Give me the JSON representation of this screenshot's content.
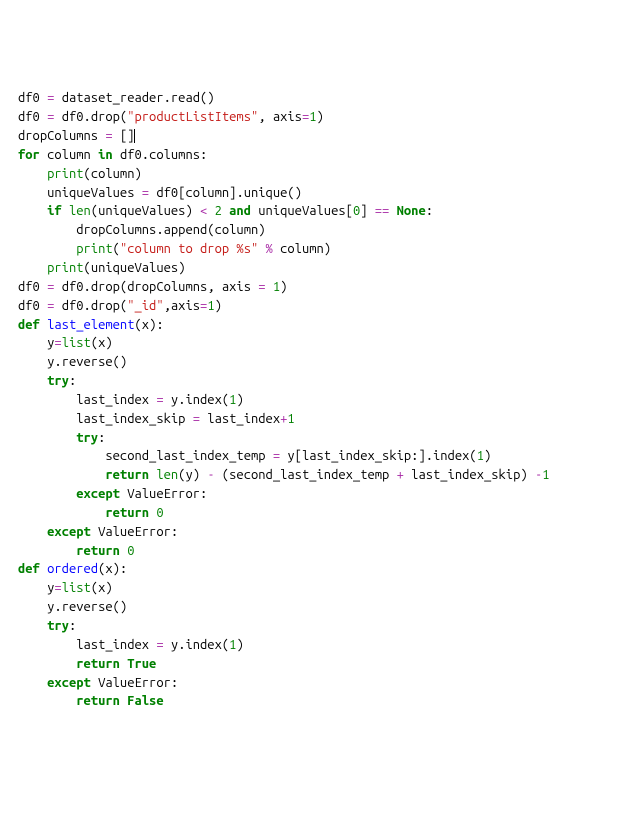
{
  "code": {
    "lines": [
      {
        "indent": 0,
        "tokens": [
          {
            "t": "df0",
            "c": "ident"
          },
          {
            "t": " ",
            "c": ""
          },
          {
            "t": "=",
            "c": "op"
          },
          {
            "t": " ",
            "c": ""
          },
          {
            "t": "dataset_reader",
            "c": "ident"
          },
          {
            "t": ".",
            "c": "dot"
          },
          {
            "t": "read",
            "c": "call"
          },
          {
            "t": "()",
            "c": "paren"
          }
        ]
      },
      {
        "indent": 0,
        "tokens": [
          {
            "t": "df0",
            "c": "ident"
          },
          {
            "t": " ",
            "c": ""
          },
          {
            "t": "=",
            "c": "op"
          },
          {
            "t": " ",
            "c": ""
          },
          {
            "t": "df0",
            "c": "ident"
          },
          {
            "t": ".",
            "c": "dot"
          },
          {
            "t": "drop",
            "c": "call"
          },
          {
            "t": "(",
            "c": "paren"
          },
          {
            "t": "\"productListItems\"",
            "c": "str"
          },
          {
            "t": ", ",
            "c": ""
          },
          {
            "t": "axis",
            "c": "ident"
          },
          {
            "t": "=",
            "c": "op"
          },
          {
            "t": "1",
            "c": "num"
          },
          {
            "t": ")",
            "c": "paren"
          }
        ]
      },
      {
        "indent": 0,
        "tokens": [
          {
            "t": "dropColumns",
            "c": "ident"
          },
          {
            "t": " ",
            "c": ""
          },
          {
            "t": "=",
            "c": "op"
          },
          {
            "t": " ",
            "c": ""
          },
          {
            "t": "[]",
            "c": "brack"
          }
        ],
        "cursor": true
      },
      {
        "indent": 0,
        "tokens": [
          {
            "t": "for",
            "c": "kw"
          },
          {
            "t": " ",
            "c": ""
          },
          {
            "t": "column",
            "c": "ident"
          },
          {
            "t": " ",
            "c": ""
          },
          {
            "t": "in",
            "c": "kw"
          },
          {
            "t": " ",
            "c": ""
          },
          {
            "t": "df0",
            "c": "ident"
          },
          {
            "t": ".",
            "c": "dot"
          },
          {
            "t": "columns",
            "c": "ident"
          },
          {
            "t": ":",
            "c": ""
          }
        ]
      },
      {
        "indent": 1,
        "tokens": [
          {
            "t": "print",
            "c": "builtin"
          },
          {
            "t": "(",
            "c": "paren"
          },
          {
            "t": "column",
            "c": "ident"
          },
          {
            "t": ")",
            "c": "paren"
          }
        ]
      },
      {
        "indent": 1,
        "tokens": [
          {
            "t": "uniqueValues",
            "c": "ident"
          },
          {
            "t": " ",
            "c": ""
          },
          {
            "t": "=",
            "c": "op"
          },
          {
            "t": " ",
            "c": ""
          },
          {
            "t": "df0",
            "c": "ident"
          },
          {
            "t": "[",
            "c": "brack"
          },
          {
            "t": "column",
            "c": "ident"
          },
          {
            "t": "]",
            "c": "brack"
          },
          {
            "t": ".",
            "c": "dot"
          },
          {
            "t": "unique",
            "c": "call"
          },
          {
            "t": "()",
            "c": "paren"
          }
        ]
      },
      {
        "indent": 1,
        "tokens": [
          {
            "t": "if",
            "c": "kw"
          },
          {
            "t": " ",
            "c": ""
          },
          {
            "t": "len",
            "c": "builtin"
          },
          {
            "t": "(",
            "c": "paren"
          },
          {
            "t": "uniqueValues",
            "c": "ident"
          },
          {
            "t": ")",
            "c": "paren"
          },
          {
            "t": " ",
            "c": ""
          },
          {
            "t": "<",
            "c": "op"
          },
          {
            "t": " ",
            "c": ""
          },
          {
            "t": "2",
            "c": "num"
          },
          {
            "t": " ",
            "c": ""
          },
          {
            "t": "and",
            "c": "kw"
          },
          {
            "t": " ",
            "c": ""
          },
          {
            "t": "uniqueValues",
            "c": "ident"
          },
          {
            "t": "[",
            "c": "brack"
          },
          {
            "t": "0",
            "c": "num"
          },
          {
            "t": "]",
            "c": "brack"
          },
          {
            "t": " ",
            "c": ""
          },
          {
            "t": "==",
            "c": "op"
          },
          {
            "t": " ",
            "c": ""
          },
          {
            "t": "None",
            "c": "none"
          },
          {
            "t": ":",
            "c": ""
          }
        ]
      },
      {
        "indent": 2,
        "tokens": [
          {
            "t": "dropColumns",
            "c": "ident"
          },
          {
            "t": ".",
            "c": "dot"
          },
          {
            "t": "append",
            "c": "call"
          },
          {
            "t": "(",
            "c": "paren"
          },
          {
            "t": "column",
            "c": "ident"
          },
          {
            "t": ")",
            "c": "paren"
          }
        ]
      },
      {
        "indent": 2,
        "tokens": [
          {
            "t": "print",
            "c": "builtin"
          },
          {
            "t": "(",
            "c": "paren"
          },
          {
            "t": "\"column to drop %s\"",
            "c": "str"
          },
          {
            "t": " ",
            "c": ""
          },
          {
            "t": "%",
            "c": "op"
          },
          {
            "t": " ",
            "c": ""
          },
          {
            "t": "column",
            "c": "ident"
          },
          {
            "t": ")",
            "c": "paren"
          }
        ]
      },
      {
        "indent": 1,
        "tokens": [
          {
            "t": "print",
            "c": "builtin"
          },
          {
            "t": "(",
            "c": "paren"
          },
          {
            "t": "uniqueValues",
            "c": "ident"
          },
          {
            "t": ")",
            "c": "paren"
          }
        ]
      },
      {
        "indent": 0,
        "tokens": [
          {
            "t": "df0",
            "c": "ident"
          },
          {
            "t": " ",
            "c": ""
          },
          {
            "t": "=",
            "c": "op"
          },
          {
            "t": " ",
            "c": ""
          },
          {
            "t": "df0",
            "c": "ident"
          },
          {
            "t": ".",
            "c": "dot"
          },
          {
            "t": "drop",
            "c": "call"
          },
          {
            "t": "(",
            "c": "paren"
          },
          {
            "t": "dropColumns",
            "c": "ident"
          },
          {
            "t": ", ",
            "c": ""
          },
          {
            "t": "axis",
            "c": "ident"
          },
          {
            "t": " ",
            "c": ""
          },
          {
            "t": "=",
            "c": "op"
          },
          {
            "t": " ",
            "c": ""
          },
          {
            "t": "1",
            "c": "num"
          },
          {
            "t": ")",
            "c": "paren"
          }
        ]
      },
      {
        "indent": 0,
        "tokens": [
          {
            "t": "df0",
            "c": "ident"
          },
          {
            "t": " ",
            "c": ""
          },
          {
            "t": "=",
            "c": "op"
          },
          {
            "t": " ",
            "c": ""
          },
          {
            "t": "df0",
            "c": "ident"
          },
          {
            "t": ".",
            "c": "dot"
          },
          {
            "t": "drop",
            "c": "call"
          },
          {
            "t": "(",
            "c": "paren"
          },
          {
            "t": "\"_id\"",
            "c": "str"
          },
          {
            "t": ",",
            "c": ""
          },
          {
            "t": "axis",
            "c": "ident"
          },
          {
            "t": "=",
            "c": "op"
          },
          {
            "t": "1",
            "c": "num"
          },
          {
            "t": ")",
            "c": "paren"
          }
        ]
      },
      {
        "indent": 0,
        "tokens": [
          {
            "t": "def",
            "c": "kw"
          },
          {
            "t": " ",
            "c": ""
          },
          {
            "t": "last_element",
            "c": "def-name"
          },
          {
            "t": "(",
            "c": "paren"
          },
          {
            "t": "x",
            "c": "ident"
          },
          {
            "t": "):",
            "c": "paren"
          }
        ]
      },
      {
        "indent": 1,
        "tokens": [
          {
            "t": "y",
            "c": "ident"
          },
          {
            "t": "=",
            "c": "op"
          },
          {
            "t": "list",
            "c": "builtin"
          },
          {
            "t": "(",
            "c": "paren"
          },
          {
            "t": "x",
            "c": "ident"
          },
          {
            "t": ")",
            "c": "paren"
          }
        ]
      },
      {
        "indent": 1,
        "tokens": [
          {
            "t": "y",
            "c": "ident"
          },
          {
            "t": ".",
            "c": "dot"
          },
          {
            "t": "reverse",
            "c": "call"
          },
          {
            "t": "()",
            "c": "paren"
          }
        ]
      },
      {
        "indent": 1,
        "tokens": [
          {
            "t": "try",
            "c": "kw"
          },
          {
            "t": ":",
            "c": ""
          }
        ]
      },
      {
        "indent": 2,
        "tokens": [
          {
            "t": "last_index",
            "c": "ident"
          },
          {
            "t": " ",
            "c": ""
          },
          {
            "t": "=",
            "c": "op"
          },
          {
            "t": " ",
            "c": ""
          },
          {
            "t": "y",
            "c": "ident"
          },
          {
            "t": ".",
            "c": "dot"
          },
          {
            "t": "index",
            "c": "call"
          },
          {
            "t": "(",
            "c": "paren"
          },
          {
            "t": "1",
            "c": "num"
          },
          {
            "t": ")",
            "c": "paren"
          }
        ]
      },
      {
        "indent": 2,
        "tokens": [
          {
            "t": "last_index_skip",
            "c": "ident"
          },
          {
            "t": " ",
            "c": ""
          },
          {
            "t": "=",
            "c": "op"
          },
          {
            "t": " ",
            "c": ""
          },
          {
            "t": "last_index",
            "c": "ident"
          },
          {
            "t": "+",
            "c": "op"
          },
          {
            "t": "1",
            "c": "num"
          }
        ]
      },
      {
        "indent": 2,
        "tokens": [
          {
            "t": "try",
            "c": "kw"
          },
          {
            "t": ":",
            "c": ""
          }
        ]
      },
      {
        "indent": 3,
        "tokens": [
          {
            "t": "second_last_index_temp",
            "c": "ident"
          },
          {
            "t": " ",
            "c": ""
          },
          {
            "t": "=",
            "c": "op"
          },
          {
            "t": " ",
            "c": ""
          },
          {
            "t": "y",
            "c": "ident"
          },
          {
            "t": "[",
            "c": "brack"
          },
          {
            "t": "last_index_skip",
            "c": "ident"
          },
          {
            "t": ":",
            "c": ""
          },
          {
            "t": "]",
            "c": "brack"
          },
          {
            "t": ".",
            "c": "dot"
          },
          {
            "t": "index",
            "c": "call"
          },
          {
            "t": "(",
            "c": "paren"
          },
          {
            "t": "1",
            "c": "num"
          },
          {
            "t": ")",
            "c": "paren"
          }
        ]
      },
      {
        "indent": 3,
        "tokens": [
          {
            "t": "return",
            "c": "kw"
          },
          {
            "t": " ",
            "c": ""
          },
          {
            "t": "len",
            "c": "builtin"
          },
          {
            "t": "(",
            "c": "paren"
          },
          {
            "t": "y",
            "c": "ident"
          },
          {
            "t": ")",
            "c": "paren"
          },
          {
            "t": " ",
            "c": ""
          },
          {
            "t": "-",
            "c": "op"
          },
          {
            "t": " ",
            "c": ""
          },
          {
            "t": "(",
            "c": "paren"
          },
          {
            "t": "second_last_index_temp",
            "c": "ident"
          },
          {
            "t": " ",
            "c": ""
          },
          {
            "t": "+",
            "c": "op"
          },
          {
            "t": " ",
            "c": ""
          },
          {
            "t": "last_index_skip",
            "c": "ident"
          },
          {
            "t": ")",
            "c": "paren"
          },
          {
            "t": " ",
            "c": ""
          },
          {
            "t": "-",
            "c": "op"
          },
          {
            "t": "1",
            "c": "num"
          }
        ]
      },
      {
        "indent": 2,
        "tokens": [
          {
            "t": "except",
            "c": "kw"
          },
          {
            "t": " ",
            "c": ""
          },
          {
            "t": "ValueError",
            "c": "ident"
          },
          {
            "t": ":",
            "c": ""
          }
        ]
      },
      {
        "indent": 3,
        "tokens": [
          {
            "t": "return",
            "c": "kw"
          },
          {
            "t": " ",
            "c": ""
          },
          {
            "t": "0",
            "c": "num"
          }
        ]
      },
      {
        "indent": 1,
        "tokens": [
          {
            "t": "except",
            "c": "kw"
          },
          {
            "t": " ",
            "c": ""
          },
          {
            "t": "ValueError",
            "c": "ident"
          },
          {
            "t": ":",
            "c": ""
          }
        ]
      },
      {
        "indent": 2,
        "tokens": [
          {
            "t": "return",
            "c": "kw"
          },
          {
            "t": " ",
            "c": ""
          },
          {
            "t": "0",
            "c": "num"
          }
        ]
      },
      {
        "indent": 0,
        "tokens": [
          {
            "t": "def",
            "c": "kw"
          },
          {
            "t": " ",
            "c": ""
          },
          {
            "t": "ordered",
            "c": "def-name"
          },
          {
            "t": "(",
            "c": "paren"
          },
          {
            "t": "x",
            "c": "ident"
          },
          {
            "t": "):",
            "c": "paren"
          }
        ]
      },
      {
        "indent": 1,
        "tokens": [
          {
            "t": "y",
            "c": "ident"
          },
          {
            "t": "=",
            "c": "op"
          },
          {
            "t": "list",
            "c": "builtin"
          },
          {
            "t": "(",
            "c": "paren"
          },
          {
            "t": "x",
            "c": "ident"
          },
          {
            "t": ")",
            "c": "paren"
          }
        ]
      },
      {
        "indent": 1,
        "tokens": [
          {
            "t": "y",
            "c": "ident"
          },
          {
            "t": ".",
            "c": "dot"
          },
          {
            "t": "reverse",
            "c": "call"
          },
          {
            "t": "()",
            "c": "paren"
          }
        ]
      },
      {
        "indent": 1,
        "tokens": [
          {
            "t": "try",
            "c": "kw"
          },
          {
            "t": ":",
            "c": ""
          }
        ]
      },
      {
        "indent": 2,
        "tokens": [
          {
            "t": "last_index",
            "c": "ident"
          },
          {
            "t": " ",
            "c": ""
          },
          {
            "t": "=",
            "c": "op"
          },
          {
            "t": " ",
            "c": ""
          },
          {
            "t": "y",
            "c": "ident"
          },
          {
            "t": ".",
            "c": "dot"
          },
          {
            "t": "index",
            "c": "call"
          },
          {
            "t": "(",
            "c": "paren"
          },
          {
            "t": "1",
            "c": "num"
          },
          {
            "t": ")",
            "c": "paren"
          }
        ]
      },
      {
        "indent": 2,
        "tokens": [
          {
            "t": "return",
            "c": "kw"
          },
          {
            "t": " ",
            "c": ""
          },
          {
            "t": "True",
            "c": "none"
          }
        ]
      },
      {
        "indent": 1,
        "tokens": [
          {
            "t": "except",
            "c": "kw"
          },
          {
            "t": " ",
            "c": ""
          },
          {
            "t": "ValueError",
            "c": "ident"
          },
          {
            "t": ":",
            "c": ""
          }
        ]
      },
      {
        "indent": 2,
        "tokens": [
          {
            "t": "return",
            "c": "kw"
          },
          {
            "t": " ",
            "c": ""
          },
          {
            "t": "False",
            "c": "none"
          }
        ]
      }
    ],
    "indent_unit": "    "
  }
}
